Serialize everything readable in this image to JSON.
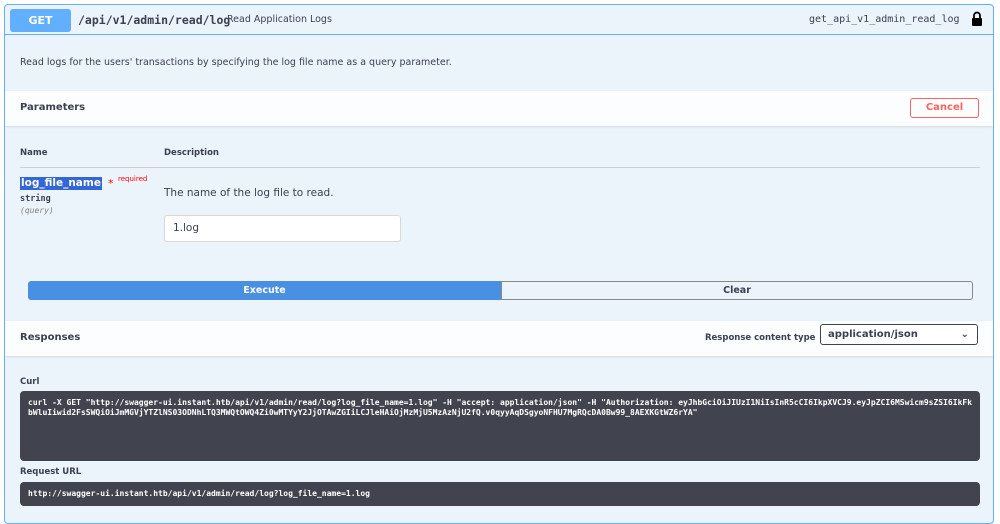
{
  "operation": {
    "method": "GET",
    "path": "/api/v1/admin/read/log",
    "summary": "Read Application Logs",
    "operation_id": "get_api_v1_admin_read_log",
    "description": "Read logs for the users' transactions by specifying the log file name as a query parameter."
  },
  "parameters": {
    "title": "Parameters",
    "cancel_label": "Cancel",
    "col_name": "Name",
    "col_description": "Description",
    "items": [
      {
        "name": "log_file_name",
        "required_star": "*",
        "required_label": "required",
        "type": "string",
        "in": "(query)",
        "description": "The name of the log file to read.",
        "value": "1.log"
      }
    ]
  },
  "actions": {
    "execute_label": "Execute",
    "clear_label": "Clear"
  },
  "responses": {
    "title": "Responses",
    "content_type_label": "Response content type",
    "content_type_value": "application/json",
    "curl_label": "Curl",
    "curl": "curl -X GET \"http://swagger-ui.instant.htb/api/v1/admin/read/log?log_file_name=1.log\" -H \"accept: application/json\" -H \"Authorization: eyJhbGciOiJIUzI1NiIsInR5cCI6IkpXVCJ9.eyJpZCI6MSwicm9sZSI6IkFkbWluIiwid2FsSWQiOiJmMGVjYTZlNS03ODNhLTQ3MWQtOWQ4Zi0wMTYyY2JjOTAwZGIiLCJleHAiOjMzMjU5MzAzNjU2fQ.v0qyyAqDSgyoNFHU7MgRQcDA0Bw99_8AEXKGtWZ6rYA\"",
    "request_url_label": "Request URL",
    "request_url": "http://swagger-ui.instant.htb/api/v1/admin/read/log?log_file_name=1.log"
  },
  "colors": {
    "get_blue": "#61affe",
    "execute_blue": "#4990e2",
    "cancel_red": "#ff6060",
    "code_bg": "#41444e"
  }
}
